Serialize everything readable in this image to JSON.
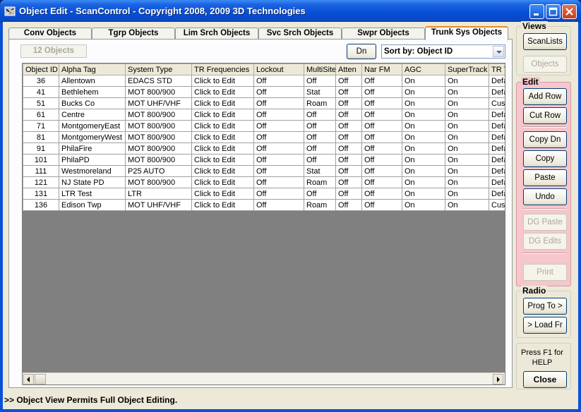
{
  "window": {
    "title": "Object Edit - ScanControl - Copyright 2008, 2009 3D Technologies"
  },
  "tabs": [
    {
      "label": "Conv Objects"
    },
    {
      "label": "Tgrp Objects"
    },
    {
      "label": "Lim Srch Objects"
    },
    {
      "label": "Svc Srch Objects"
    },
    {
      "label": "Swpr Objects"
    },
    {
      "label": "Trunk Sys Objects",
      "active": true
    }
  ],
  "toolbar": {
    "object_count": "12 Objects",
    "dn_label": "Dn",
    "sort_label": "Sort by: Object ID"
  },
  "table": {
    "columns": [
      "Object ID",
      "Alpha Tag",
      "System Type",
      "TR Frequencies",
      "Lockout",
      "MultiSite",
      "Atten",
      "Nar FM",
      "AGC",
      "SuperTrack",
      "TR Type"
    ],
    "rows": [
      [
        "36",
        "Allentown",
        "EDACS STD",
        "Click to Edit",
        "Off",
        "Off",
        "Off",
        "Off",
        "On",
        "On",
        "Default"
      ],
      [
        "41",
        "Bethlehem",
        "MOT 800/900",
        "Click to Edit",
        "Off",
        "Stat",
        "Off",
        "Off",
        "On",
        "On",
        "Default"
      ],
      [
        "51",
        "Bucks Co",
        "MOT UHF/VHF",
        "Click to Edit",
        "Off",
        "Roam",
        "Off",
        "Off",
        "On",
        "On",
        "Custom"
      ],
      [
        "61",
        "Centre",
        "MOT 800/900",
        "Click to Edit",
        "Off",
        "Off",
        "Off",
        "Off",
        "On",
        "On",
        "Default"
      ],
      [
        "71",
        "MontgomeryEast",
        "MOT 800/900",
        "Click to Edit",
        "Off",
        "Off",
        "Off",
        "Off",
        "On",
        "On",
        "Default"
      ],
      [
        "81",
        "MontgomeryWest",
        "MOT 800/900",
        "Click to Edit",
        "Off",
        "Off",
        "Off",
        "Off",
        "On",
        "On",
        "Default"
      ],
      [
        "91",
        "PhilaFire",
        "MOT 800/900",
        "Click to Edit",
        "Off",
        "Off",
        "Off",
        "Off",
        "On",
        "On",
        "Default"
      ],
      [
        "101",
        "PhilaPD",
        "MOT 800/900",
        "Click to Edit",
        "Off",
        "Off",
        "Off",
        "Off",
        "On",
        "On",
        "Default"
      ],
      [
        "111",
        "Westmoreland",
        "P25 AUTO",
        "Click to Edit",
        "Off",
        "Stat",
        "Off",
        "Off",
        "On",
        "On",
        "Default"
      ],
      [
        "121",
        "NJ State PD",
        "MOT 800/900",
        "Click to Edit",
        "Off",
        "Roam",
        "Off",
        "Off",
        "On",
        "On",
        "Default"
      ],
      [
        "131",
        "LTR Test",
        "LTR",
        "Click to Edit",
        "Off",
        "Off",
        "Off",
        "Off",
        "On",
        "On",
        "Default"
      ],
      [
        "136",
        "Edison Twp",
        "MOT UHF/VHF",
        "Click to Edit",
        "Off",
        "Roam",
        "Off",
        "Off",
        "On",
        "On",
        "Custom"
      ]
    ]
  },
  "status": {
    "text": ">> Object View Permits Full Object Editing."
  },
  "views": {
    "label": "Views",
    "scanlists": "ScanLists",
    "objects": "Objects"
  },
  "edit": {
    "label": "Edit",
    "add_row": "Add Row",
    "cut_row": "Cut Row",
    "copy_dn": "Copy Dn",
    "copy": "Copy",
    "paste": "Paste",
    "undo": "Undo",
    "dg_paste": "DG Paste",
    "dg_edits": "DG Edits",
    "print": "Print"
  },
  "radio": {
    "label": "Radio",
    "prog_to": "Prog To >",
    "load_fr": "> Load Fr"
  },
  "help": {
    "text": "Press F1 for HELP",
    "close": "Close"
  },
  "colors": {
    "title_bar": "#0751d8",
    "edit_panel": "#f5c6cc",
    "active_tab_accent": "#e68b2c"
  }
}
